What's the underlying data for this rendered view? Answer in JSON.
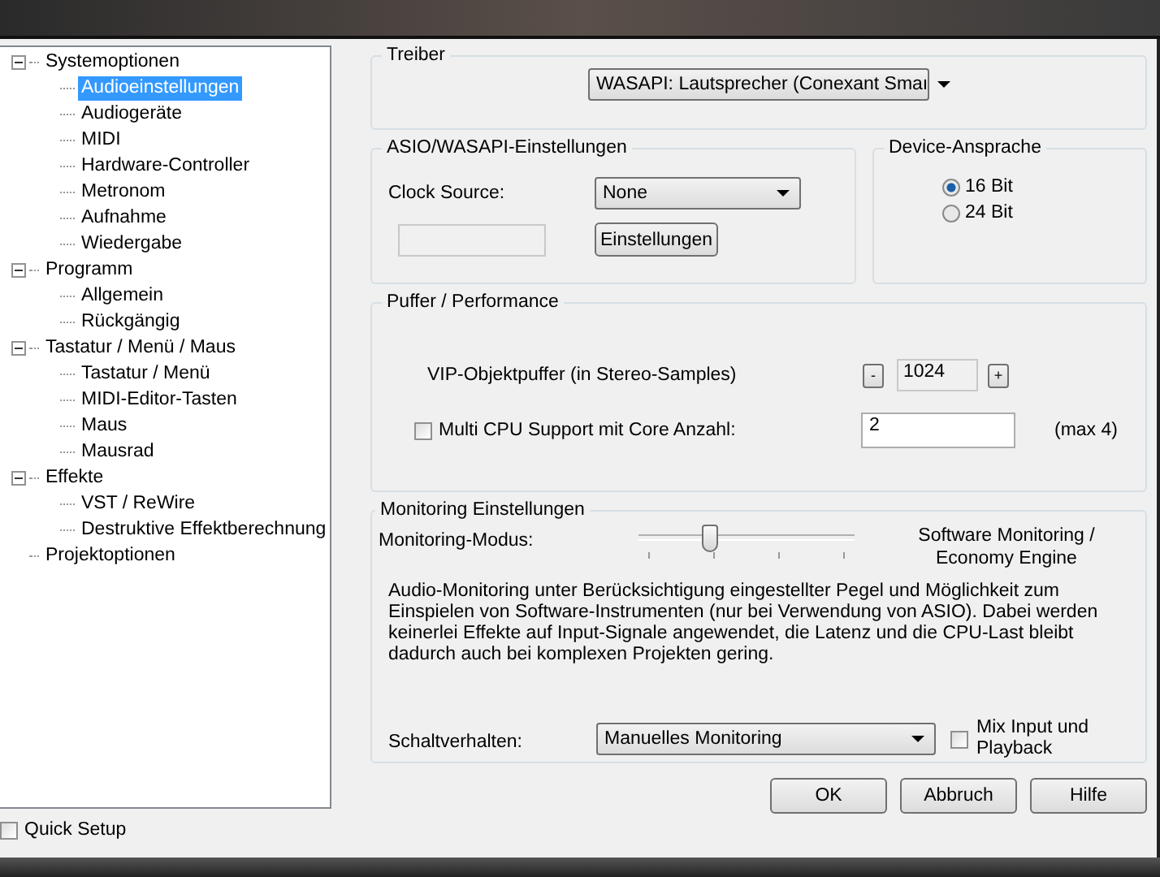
{
  "tree": [
    {
      "label": "Systemoptionen",
      "expanded": true,
      "selected": false,
      "children": [
        {
          "label": "Audioeinstellungen",
          "selected": true
        },
        {
          "label": "Audiogeräte",
          "selected": false
        },
        {
          "label": "MIDI",
          "selected": false
        },
        {
          "label": "Hardware-Controller",
          "selected": false
        },
        {
          "label": "Metronom",
          "selected": false
        },
        {
          "label": "Aufnahme",
          "selected": false
        },
        {
          "label": "Wiedergabe",
          "selected": false
        }
      ]
    },
    {
      "label": "Programm",
      "expanded": true,
      "selected": false,
      "children": [
        {
          "label": "Allgemein",
          "selected": false
        },
        {
          "label": "Rückgängig",
          "selected": false
        }
      ]
    },
    {
      "label": "Tastatur / Menü / Maus",
      "expanded": true,
      "selected": false,
      "children": [
        {
          "label": "Tastatur / Menü",
          "selected": false
        },
        {
          "label": "MIDI-Editor-Tasten",
          "selected": false
        },
        {
          "label": "Maus",
          "selected": false
        },
        {
          "label": "Mausrad",
          "selected": false
        }
      ]
    },
    {
      "label": "Effekte",
      "expanded": true,
      "selected": false,
      "children": [
        {
          "label": "VST / ReWire",
          "selected": false
        },
        {
          "label": "Destruktive Effektberechnung",
          "selected": false
        }
      ]
    },
    {
      "label": "Projektoptionen",
      "selected": false
    }
  ],
  "quick_setup": {
    "label": "Quick Setup",
    "checked": false
  },
  "treiber": {
    "title": "Treiber",
    "driver": "WASAPI: Lautsprecher (Conexant Smaı"
  },
  "asio": {
    "title": "ASIO/WASAPI-Einstellungen",
    "clock_label": "Clock Source:",
    "clock_value": "None",
    "settings_button": "Einstellungen"
  },
  "device": {
    "title": "Device-Ansprache",
    "options": [
      {
        "label": "16 Bit",
        "selected": true
      },
      {
        "label": "24 Bit",
        "selected": false
      }
    ]
  },
  "puffer": {
    "title": "Puffer / Performance",
    "vip_label": "VIP-Objektpuffer (in Stereo-Samples)",
    "minus": "-",
    "vip_value": "1024",
    "plus": "+",
    "cpu_label": "Multi CPU Support mit Core Anzahl:",
    "cpu_checked": false,
    "cpu_value": "2",
    "cpu_max": "(max 4)"
  },
  "monitoring": {
    "title": "Monitoring Einstellungen",
    "mode_label": "Monitoring-Modus:",
    "level": 0.333,
    "mode_value": "Software Monitoring / Economy Engine",
    "description": "Audio-Monitoring unter Berücksichtigung eingestellter Pegel und Möglichkeit zum Einspielen von Software-Instrumenten (nur bei Verwendung von ASIO). Dabei werden keinerlei Effekte auf Input-Signale angewendet, die Latenz und die CPU-Last bleibt dadurch auch bei komplexen Projekten gering.",
    "switch_label": "Schaltverhalten:",
    "switch_value": "Manuelles Monitoring",
    "mix_label": "Mix Input und Playback",
    "mix_checked": false
  },
  "buttons": [
    "OK",
    "Abbruch",
    "Hilfe"
  ]
}
